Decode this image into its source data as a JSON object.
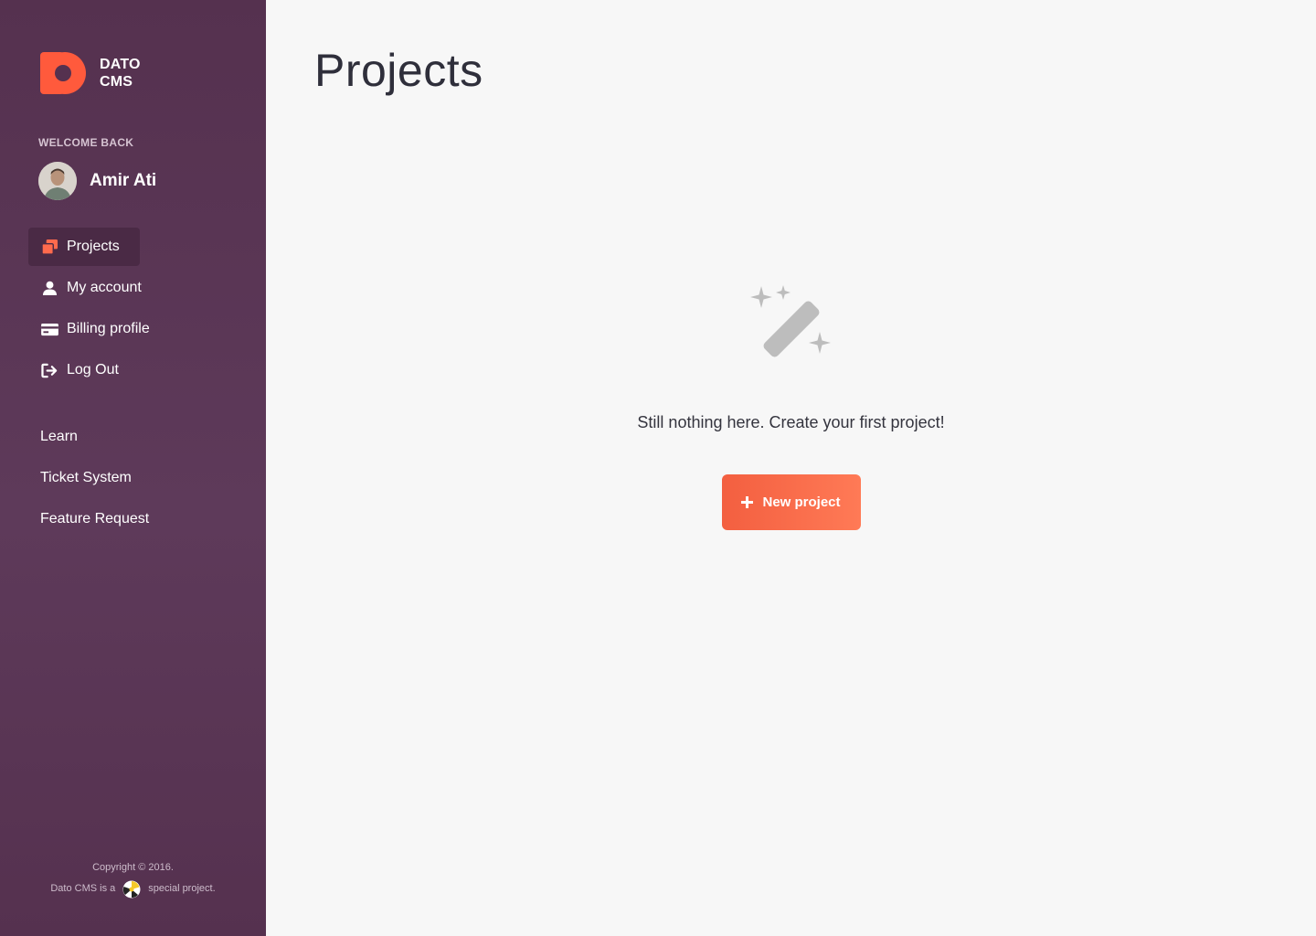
{
  "brand": {
    "line1": "DATO",
    "line2": "CMS",
    "color": "#ff5a3c"
  },
  "sidebar": {
    "welcome": "WELCOME BACK",
    "user_name": "Amir Ati",
    "nav": [
      {
        "label": "Projects",
        "icon": "projects-icon",
        "active": true
      },
      {
        "label": "My account",
        "icon": "user-icon"
      },
      {
        "label": "Billing profile",
        "icon": "credit-card-icon"
      },
      {
        "label": "Log Out",
        "icon": "logout-icon"
      }
    ],
    "links": [
      {
        "label": "Learn"
      },
      {
        "label": "Ticket System"
      },
      {
        "label": "Feature Request"
      }
    ],
    "footer": {
      "copyright": "Copyright © 2016.",
      "pre": "Dato CMS is a",
      "post": "special project."
    }
  },
  "main": {
    "title": "Projects",
    "empty_icon": "magic-wand-icon",
    "empty_text": "Still nothing here. Create your first project!",
    "new_button": "New project",
    "accent": "#f35f40"
  }
}
